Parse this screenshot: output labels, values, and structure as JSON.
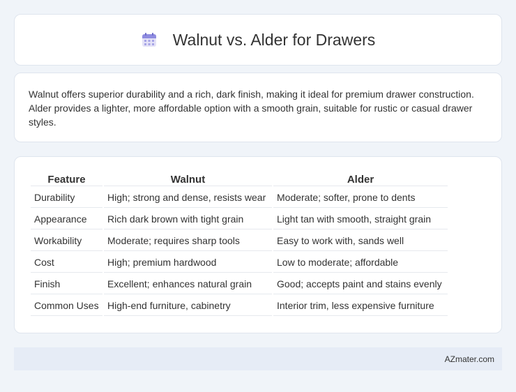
{
  "header": {
    "title": "Walnut vs. Alder for Drawers",
    "icon": "calendar-icon"
  },
  "summary": {
    "text": "Walnut offers superior durability and a rich, dark finish, making it ideal for premium drawer construction. Alder provides a lighter, more affordable option with a smooth grain, suitable for rustic or casual drawer styles."
  },
  "table": {
    "headers": [
      "Feature",
      "Walnut",
      "Alder"
    ],
    "rows": [
      [
        "Durability",
        "High; strong and dense, resists wear",
        "Moderate; softer, prone to dents"
      ],
      [
        "Appearance",
        "Rich dark brown with tight grain",
        "Light tan with smooth, straight grain"
      ],
      [
        "Workability",
        "Moderate; requires sharp tools",
        "Easy to work with, sands well"
      ],
      [
        "Cost",
        "High; premium hardwood",
        "Low to moderate; affordable"
      ],
      [
        "Finish",
        "Excellent; enhances natural grain",
        "Good; accepts paint and stains evenly"
      ],
      [
        "Common Uses",
        "High-end furniture, cabinetry",
        "Interior trim, less expensive furniture"
      ]
    ]
  },
  "footer": {
    "brand": "AZmater.com"
  }
}
